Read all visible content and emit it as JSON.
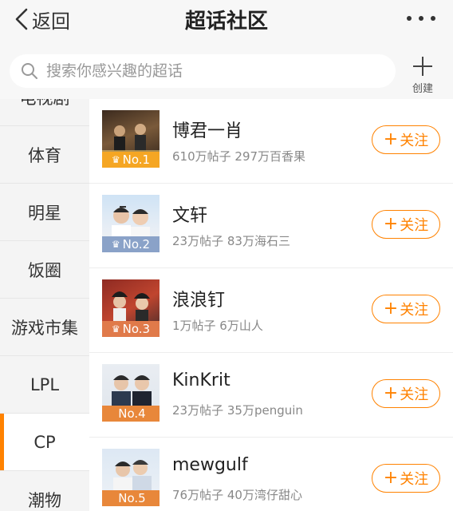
{
  "header": {
    "back_label": "返回",
    "title": "超话社区"
  },
  "search": {
    "placeholder": "搜索你感兴趣的超话",
    "create_label": "创建"
  },
  "sidebar": {
    "active": "CP",
    "items": [
      {
        "label": "电视剧"
      },
      {
        "label": "体育"
      },
      {
        "label": "明星"
      },
      {
        "label": "饭圈"
      },
      {
        "label": "游戏市集"
      },
      {
        "label": "LPL"
      },
      {
        "label": "CP"
      },
      {
        "label": "潮物"
      }
    ]
  },
  "list": [
    {
      "rank": "No.1",
      "name": "博君一肖",
      "stats": "610万帖子 297万百香果",
      "follow": "关注",
      "badge_color": "#f5a623",
      "crown": "♛"
    },
    {
      "rank": "No.2",
      "name": "文轩",
      "stats": "23万帖子 83万海石三",
      "follow": "关注",
      "badge_color": "#8aa2c8",
      "crown": "♛"
    },
    {
      "rank": "No.3",
      "name": "浪浪钉",
      "stats": "1万帖子 6万山人",
      "follow": "关注",
      "badge_color": "#e07a4a",
      "crown": "♛"
    },
    {
      "rank": "No.4",
      "name": "KinKrit",
      "stats": "23万帖子 35万penguin",
      "follow": "关注",
      "badge_color": "#e8873a",
      "crown": ""
    },
    {
      "rank": "No.5",
      "name": "mewgulf",
      "stats": "76万帖子 40万湾仔甜心",
      "follow": "关注",
      "badge_color": "#e8873a",
      "crown": ""
    }
  ]
}
